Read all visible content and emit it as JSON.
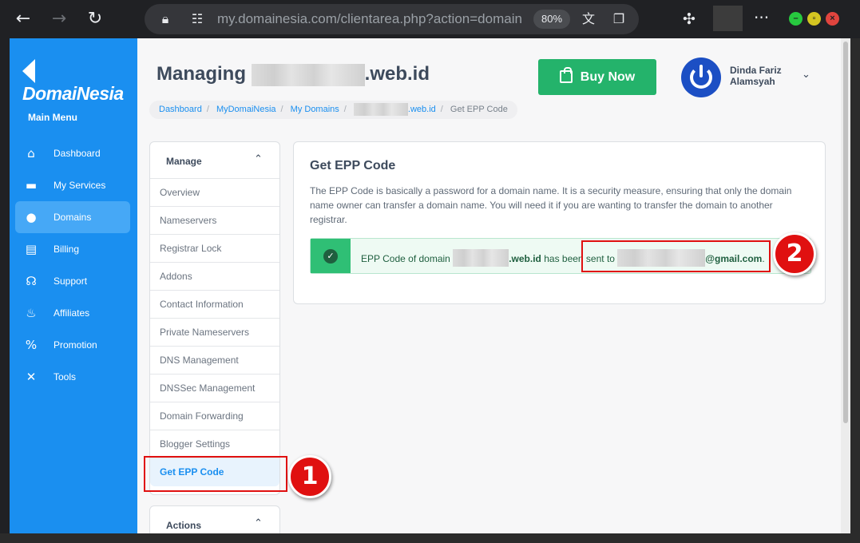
{
  "browser": {
    "url": "my.domainesia.com/clientarea.php?action=domain",
    "zoom": "80%",
    "icons": [
      "back-icon",
      "forward-icon",
      "reload-icon",
      "lock-icon",
      "site-settings-icon",
      "translate-icon",
      "reading-list-icon",
      "extensions-icon",
      "more-icon"
    ]
  },
  "sidebar": {
    "brand": "DomaiNesia",
    "menu_title": "Main Menu",
    "items": [
      {
        "label": "Dashboard",
        "icon": "home-icon",
        "glyph": "⌂"
      },
      {
        "label": "My Services",
        "icon": "server-icon",
        "glyph": "▬"
      },
      {
        "label": "Domains",
        "icon": "globe-icon",
        "glyph": "●"
      },
      {
        "label": "Billing",
        "icon": "receipt-icon",
        "glyph": "▤"
      },
      {
        "label": "Support",
        "icon": "headset-icon",
        "glyph": "☊"
      },
      {
        "label": "Affiliates",
        "icon": "handshake-icon",
        "glyph": "♨"
      },
      {
        "label": "Promotion",
        "icon": "percent-icon",
        "glyph": "%"
      },
      {
        "label": "Tools",
        "icon": "tools-icon",
        "glyph": "✕"
      }
    ],
    "active": "Domains",
    "color": "#1a8ff0"
  },
  "header": {
    "title_prefix": "Managing",
    "title_suffix": ".web.id",
    "buy_button": "Buy Now",
    "user_name": "Dinda Fariz Alamsyah"
  },
  "breadcrumb": {
    "items": [
      "Dashboard",
      "MyDomaiNesia",
      "My Domains"
    ],
    "domain_suffix": ".web.id",
    "current": "Get EPP Code"
  },
  "manage": {
    "title": "Manage",
    "items": [
      "Overview",
      "Nameservers",
      "Registrar Lock",
      "Addons",
      "Contact Information",
      "Private Nameservers",
      "DNS Management",
      "DNSSec Management",
      "Domain Forwarding",
      "Blogger Settings",
      "Get EPP Code"
    ],
    "active": "Get EPP Code"
  },
  "actions": {
    "title": "Actions"
  },
  "content": {
    "title": "Get EPP Code",
    "description": "The EPP Code is basically a password for a domain name. It is a security measure, ensuring that only the domain name owner can transfer a domain name. You will need it if you are wanting to transfer the domain to another registrar.",
    "alert": {
      "prefix": "EPP Code of domain",
      "domain_suffix": ".web.id",
      "middle": "has been sent to",
      "email_suffix": "@gmail.com",
      "end": "."
    }
  },
  "annotations": {
    "badge_1": "1",
    "badge_2": "2",
    "color": "#e01010"
  }
}
